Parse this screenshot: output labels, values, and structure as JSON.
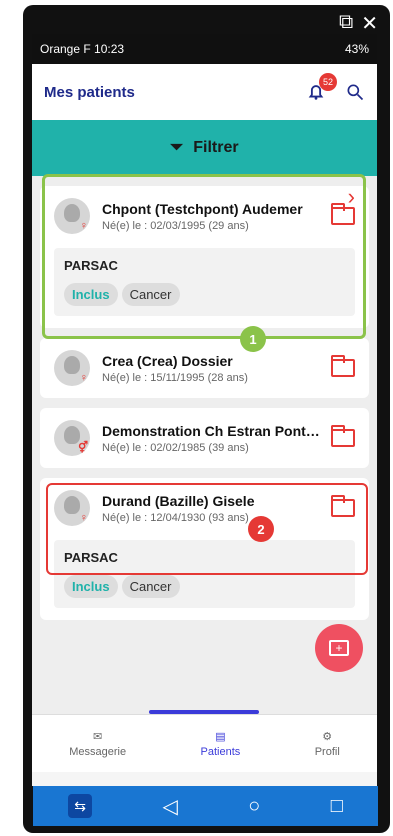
{
  "window": {
    "restore_icon": "external-window-icon",
    "close_icon": "close-icon"
  },
  "status": {
    "carrier": "Orange F",
    "time": "10:23",
    "battery": "43%"
  },
  "header": {
    "title": "Mes patients",
    "badge": "52"
  },
  "filter": {
    "label": "Filtrer"
  },
  "patients": [
    {
      "name": "Chpont (Testchpont) Audemer",
      "birth": "Né(e) le : 02/03/1995 (29 ans)",
      "study": "PARSAC",
      "tags": [
        "Inclus",
        "Cancer"
      ],
      "sex": "♀"
    },
    {
      "name": "Crea (Crea) Dossier",
      "birth": "Né(e) le : 15/11/1995 (28 ans)",
      "sex": "♀"
    },
    {
      "name": "Demonstration  Ch Estran Pont…",
      "birth": "Né(e) le : 02/02/1985 (39 ans)",
      "sex": "⚥"
    },
    {
      "name": "Durand (Bazille) Gisele",
      "birth": "Né(e) le : 12/04/1930 (93 ans)",
      "study": "PARSAC",
      "tags": [
        "Inclus",
        "Cancer"
      ],
      "sex": "♀"
    }
  ],
  "annotations": {
    "green": "1",
    "red": "2"
  },
  "nav": {
    "messagerie": "Messagerie",
    "patients": "Patients",
    "profil": "Profil"
  },
  "system_nav": {
    "back": "❮",
    "home": "○",
    "recents": "|||"
  }
}
